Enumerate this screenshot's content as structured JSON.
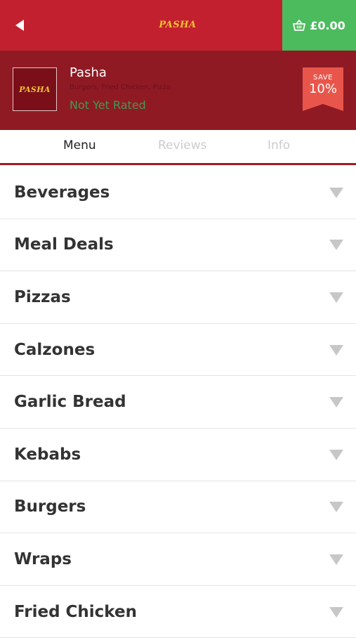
{
  "header": {
    "logo_text": "PASHA",
    "basket_total": "£0.00",
    "back_icon": "back-arrow-icon",
    "basket_icon": "basket-icon",
    "colors": {
      "primary": "#c3202f",
      "dark": "#8f1a24",
      "basket": "#4cbb5e",
      "logo": "#f1c232"
    }
  },
  "restaurant": {
    "logo_text": "PASHA",
    "name": "Pasha",
    "cuisine": "Burgers, Fried Chicken, Pizza",
    "rating": "Not Yet Rated",
    "save_label": "SAVE",
    "save_value": "10%",
    "save_color": "#e8564b"
  },
  "tabs": [
    {
      "label": "Menu",
      "active": true
    },
    {
      "label": "Reviews",
      "active": false
    },
    {
      "label": "Info",
      "active": false
    }
  ],
  "menu": {
    "chevron_icon": "chevron-down-icon",
    "categories": [
      "Beverages",
      "Meal Deals",
      "Pizzas",
      "Calzones",
      "Garlic Bread",
      "Kebabs",
      "Burgers",
      "Wraps",
      "Fried Chicken"
    ]
  }
}
